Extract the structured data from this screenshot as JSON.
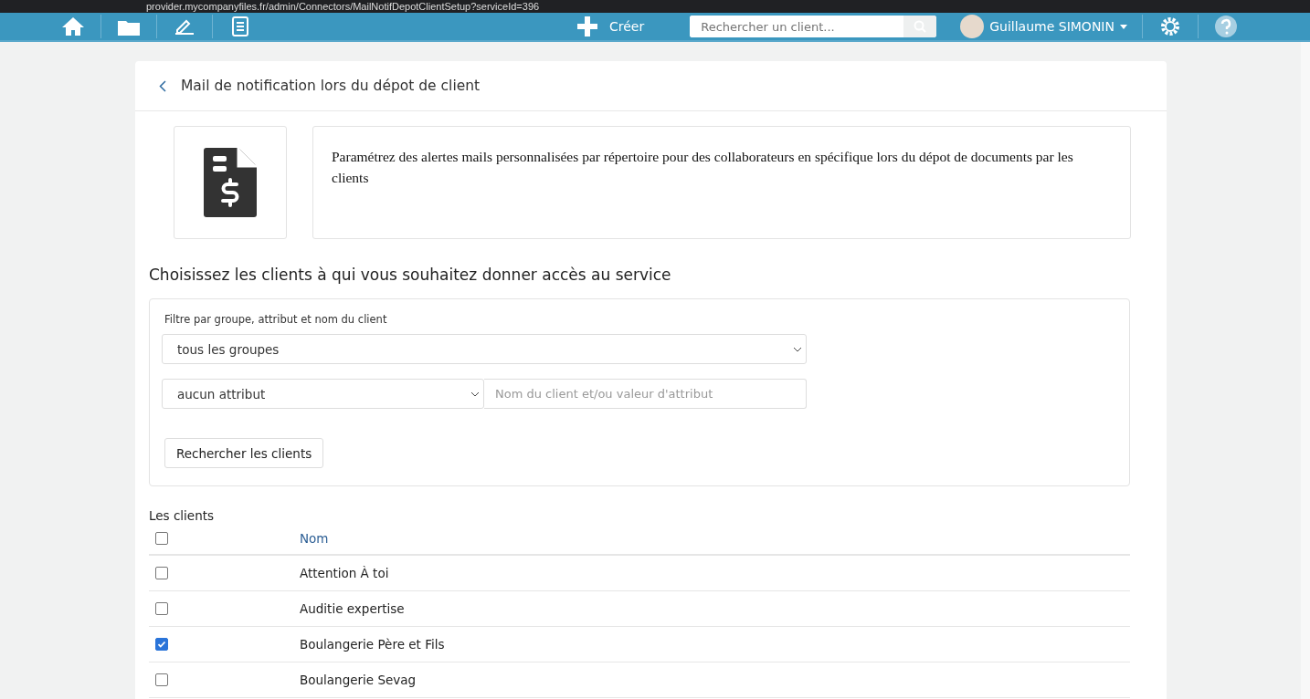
{
  "browser": {
    "url": "provider.mycompanyfiles.fr/admin/Connectors/MailNotifDepotClientSetup?serviceId=396"
  },
  "navbar": {
    "create_label": "Créer",
    "search": {
      "placeholder": "Rechercher un client..."
    },
    "user_name": "Guillaume SIMONIN"
  },
  "page": {
    "title": "Mail de notification lors du dépot de client",
    "description": "Paramétrez des alertes mails personnalisées par répertoire pour des collaborateurs en spécifique lors du dépot de documents par les clients"
  },
  "access": {
    "heading": "Choisissez les clients à qui vous souhaitez donner accès au service",
    "filter": {
      "label": "Filtre par groupe, attribut et nom du client",
      "group_select": "tous les groupes",
      "attribute_select": "aucun attribut",
      "name_field": {
        "placeholder": "Nom du client et/ou valeur d'attribut"
      },
      "search_button": "Rechercher les clients"
    }
  },
  "clients": {
    "title": "Les clients",
    "select_all": {
      "checked": false
    },
    "column": "Nom",
    "rows": [
      {
        "name": "Attention À toi",
        "checked": false
      },
      {
        "name": "Auditie expertise",
        "checked": false
      },
      {
        "name": "Boulangerie Père et Fils",
        "checked": true
      },
      {
        "name": "Boulangerie Sevag",
        "checked": false
      }
    ]
  }
}
